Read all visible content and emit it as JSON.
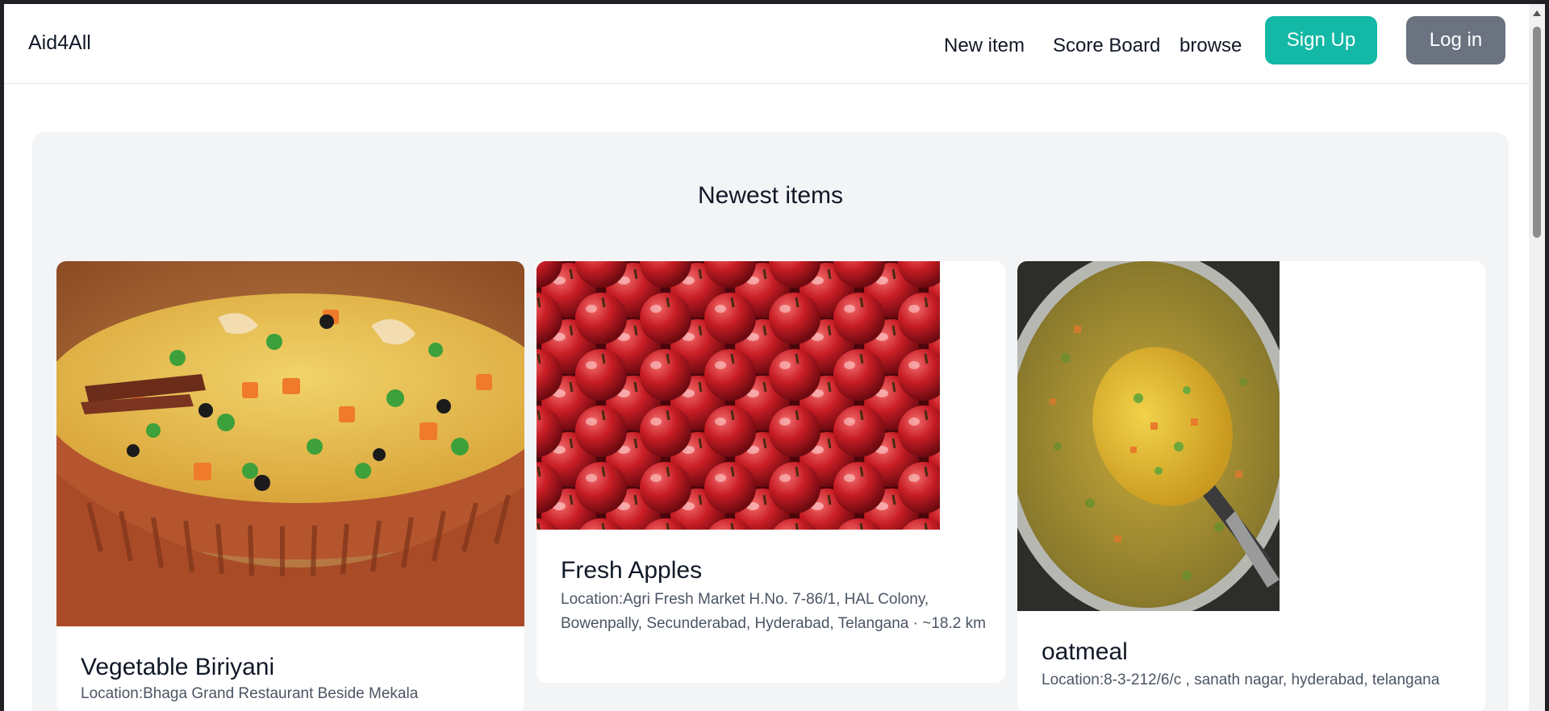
{
  "nav": {
    "brand": "Aid4All",
    "links": [
      "New item",
      "Score Board",
      "browse"
    ],
    "signup_label": "Sign Up",
    "login_label": "Log in"
  },
  "main": {
    "section_title": "Newest items",
    "cards": [
      {
        "title": "Vegetable Biriyani",
        "location": "Location:Bhaga Grand Restaurant Beside Mekala"
      },
      {
        "title": "Fresh Apples",
        "location": "Location:Agri Fresh Market H.No. 7-86/1, HAL Colony, Bowenpally, Secunderabad, Hyderabad, Telangana · ~18.2 km"
      },
      {
        "title": "oatmeal",
        "location": "Location:8-3-212/6/c , sanath nagar, hyderabad, telangana"
      }
    ]
  },
  "colors": {
    "signup": "#14b8a6",
    "login": "#6b7280",
    "section_bg": "#f3f4f6"
  }
}
